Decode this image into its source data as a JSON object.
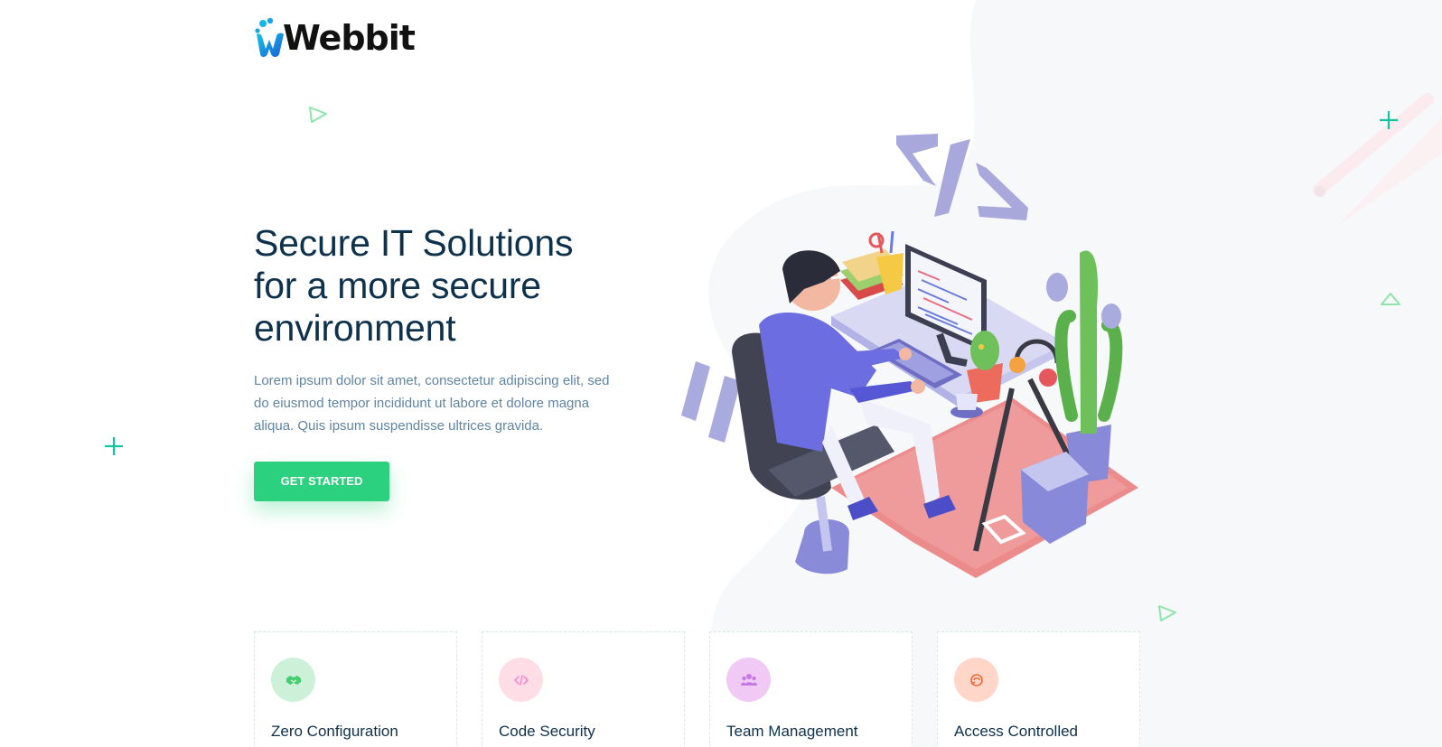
{
  "brand": {
    "logo_text": "Webbit"
  },
  "hero": {
    "title_line1": "Secure IT Solutions",
    "title_line2": "for a more secure",
    "title_line3": "environment",
    "description": "Lorem ipsum dolor sit amet, consectetur adipiscing elit, sed do eiusmod tempor incididunt ut labore et dolore magna aliqua. Quis ipsum suspendisse ultrices gravida.",
    "cta_label": "GET STARTED"
  },
  "features": [
    {
      "title": "Zero Configuration",
      "icon": "handshake-icon",
      "icon_bg": "#cdf1d8",
      "icon_color": "#44ce6f"
    },
    {
      "title": "Code Security",
      "icon": "code-icon",
      "icon_bg": "#ffdde6",
      "icon_color": "#f78acb"
    },
    {
      "title": "Team Management",
      "icon": "users-icon",
      "icon_bg": "#f0c9f5",
      "icon_color": "#c679e3"
    },
    {
      "title": "Access Controlled",
      "icon": "settings-icon",
      "icon_bg": "#ffd6c7",
      "icon_color": "#eb6b3d"
    }
  ],
  "colors": {
    "accent": "#2bd17e",
    "heading": "#0e314c",
    "body_text": "#6084a4",
    "decor_teal": "#13c4a1"
  }
}
